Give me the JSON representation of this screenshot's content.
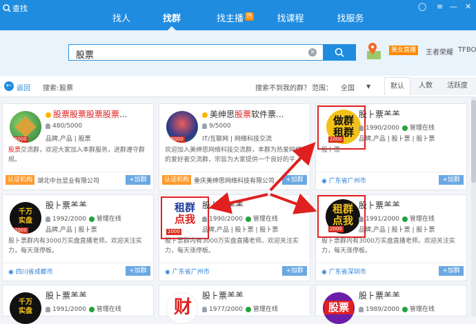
{
  "window": {
    "title": "查找"
  },
  "nav": {
    "tabs": [
      {
        "label": "找人"
      },
      {
        "label": "找群"
      },
      {
        "label": "找主播",
        "badge": "热"
      },
      {
        "label": "找课程"
      },
      {
        "label": "找服务"
      }
    ]
  },
  "search": {
    "value": "股票",
    "live_badge": "美女直播",
    "promo_1": "王者荣耀",
    "promo_2": "TFBOY"
  },
  "filters": {
    "back": "返回",
    "search_prefix": "搜索:",
    "search_term": "股票",
    "not_found": "搜索不到我的群？",
    "range_label": "范围：",
    "range_value": "全国",
    "sort": [
      "默认",
      "人数",
      "活跃度"
    ]
  },
  "cards": [
    {
      "title_hl": "股票股票股票股票",
      "title_rest": "...",
      "members": "480/5000",
      "tags": "品牌,产品 | 股票",
      "desc_hl": "股票",
      "desc": "交流群，欢迎大家加入本群服务，进群遵守群规。",
      "verify": "认证机构",
      "org": "湖北中台显业有限公司",
      "join": "+加群",
      "logo_num": "5000"
    },
    {
      "title_pre": "美绅思",
      "title_hl": "股票",
      "title_rest": "软件票...",
      "members": "9/5000",
      "tags": "IT/互联网 | 网络科技交流",
      "desc": "欢迎加入美绅思网络科技交流群，本群为热爱网络的爱好者交流群，宗旨为大家提供一个良好的平...",
      "verify": "认证机构",
      "org": "重庆美绅思网络科技有限公司",
      "join": "+加群",
      "logo_num": "5000"
    },
    {
      "title_rest": "股⺊票⺷⺷",
      "members": "1990/2000",
      "status": "管理在线",
      "tags": "品牌,产品 | 股⺊票 | 股⺊票",
      "desc": "股⺊票",
      "location": "广东省广州市",
      "join": "+加群",
      "logo_text_1": "做群",
      "logo_text_2": "租群",
      "logo_num": "2000"
    },
    {
      "title_rest": "股⺊票⺷⺷",
      "members": "1992/2000",
      "status": "管理在线",
      "tags": "品牌,产品 | 股⺊票",
      "desc": "股⺊票群内有3000万实盘直播老师。欢迎关注实力，每天涨停板。",
      "location": "四川省成都市",
      "join": "+加群",
      "logo_text_1": "千万",
      "logo_text_2": "实盘",
      "logo_num": "2000"
    },
    {
      "title_rest": "股⺊票⺷⺷",
      "members": "1990/2000",
      "status": "管理在线",
      "tags": "品牌,产品 | 股⺊票 | 股⺊票",
      "desc": "股⺊票群内有3000万实盘直播老师。欢迎关注实力，每天涨停板。",
      "location": "广东省广州市",
      "join": "+加群",
      "logo_text_1": "租群",
      "logo_text_2": "点我",
      "logo_num": "2000"
    },
    {
      "title_rest": "股⺊票⺷⺷",
      "members": "1991/2000",
      "status": "管理在线",
      "tags": "品牌,产品 | 股⺊票 | 股⺊票",
      "desc": "股⺊票群内有3000万实盘直播老师。欢迎关注实力，每天涨停板。",
      "location": "广东省深圳市",
      "join": "+加群",
      "logo_text_1": "租群",
      "logo_text_2": "点我",
      "logo_num": "2000"
    },
    {
      "title_rest": "股⺊票⺷⺷",
      "members": "1991/2000",
      "status": "管理在线",
      "logo_text_1": "千万",
      "logo_text_2": "实盘"
    },
    {
      "title_rest": "股⺊票⺷⺷",
      "members": "1977/2000",
      "status": "管理在线",
      "logo_text_1": "财"
    },
    {
      "title_rest": "股⺊票⺷⺷",
      "members": "1989/2000",
      "status": "管理在线",
      "logo_text_1": "股票"
    }
  ],
  "colors": {
    "brand": "#1f8ce0",
    "highlight": "#e02020",
    "verify": "#ff9a2f",
    "online": "#21a33b"
  }
}
